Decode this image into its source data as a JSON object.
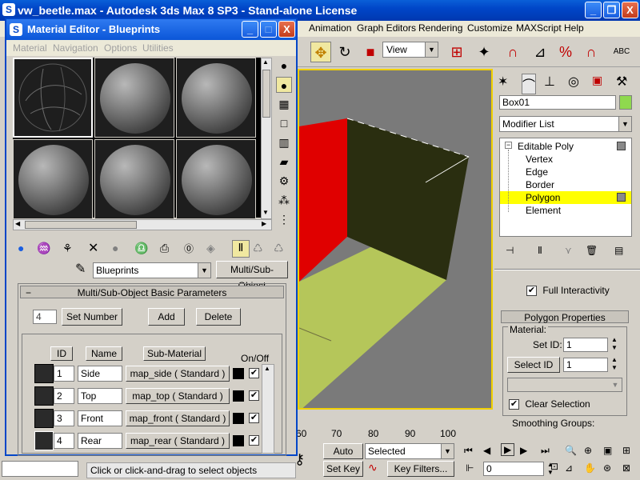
{
  "main_window": {
    "title": "vw_beetle.max - Autodesk 3ds Max 8 SP3 - Stand-alone License",
    "controls": {
      "minimize": "_",
      "maximize": "❐",
      "close": "X"
    }
  },
  "menubar": {
    "items": [
      "Animation",
      "Graph Editors",
      "Rendering",
      "Customize",
      "MAXScript",
      "Help"
    ]
  },
  "toolbar": {
    "view_dropdown": "View"
  },
  "timeline": {
    "ticks": [
      "60",
      "70",
      "80",
      "90",
      "100"
    ]
  },
  "command_panel": {
    "object_name": "Box01",
    "object_color": "#8fd94e",
    "modifier_list": "Modifier List",
    "stack": [
      {
        "label": "Editable Poly",
        "indent": 0,
        "selected": false
      },
      {
        "label": "Vertex",
        "indent": 1,
        "selected": false
      },
      {
        "label": "Edge",
        "indent": 1,
        "selected": false
      },
      {
        "label": "Border",
        "indent": 1,
        "selected": false
      },
      {
        "label": "Polygon",
        "indent": 1,
        "selected": true
      },
      {
        "label": "Element",
        "indent": 1,
        "selected": false
      }
    ],
    "full_interactivity": "Full Interactivity",
    "polygon_properties": "Polygon Properties",
    "material_label": "Material:",
    "set_id_label": "Set ID:",
    "set_id_value": "1",
    "select_id_button": "Select ID",
    "select_id_value": "1",
    "clear_selection": "Clear Selection",
    "smoothing_groups": "Smoothing Groups:"
  },
  "material_editor": {
    "title": "Material Editor - Blueprints",
    "menu": [
      "Material",
      "Navigation",
      "Options",
      "Utilities"
    ],
    "material_name": "Blueprints",
    "material_type": "Multi/Sub-Object",
    "rollout_title": "Multi/Sub-Object Basic Parameters",
    "count": "4",
    "set_number": "Set Number",
    "add": "Add",
    "delete": "Delete",
    "columns": {
      "id": "ID",
      "name": "Name",
      "sub_material": "Sub-Material",
      "on_off": "On/Off"
    },
    "rows": [
      {
        "id": "1",
        "name": "Side",
        "map": "map_side  ( Standard )"
      },
      {
        "id": "2",
        "name": "Top",
        "map": "map_top  ( Standard )"
      },
      {
        "id": "3",
        "name": "Front",
        "map": "map_front  ( Standard )"
      },
      {
        "id": "4",
        "name": "Rear",
        "map": "map_rear  ( Standard )"
      }
    ]
  },
  "bottom": {
    "status": "Click or click-and-drag to select objects",
    "auto_key": "Auto Key",
    "selected": "Selected",
    "set_key": "Set Key",
    "key_filters": "Key Filters...",
    "frame": "0"
  },
  "colors": {
    "selection": "#ffff00",
    "viewport_bg": "#7a7a7a",
    "wall_red": "#e00000",
    "wall_dark": "#2a2e10",
    "floor": "#b5c65a"
  }
}
